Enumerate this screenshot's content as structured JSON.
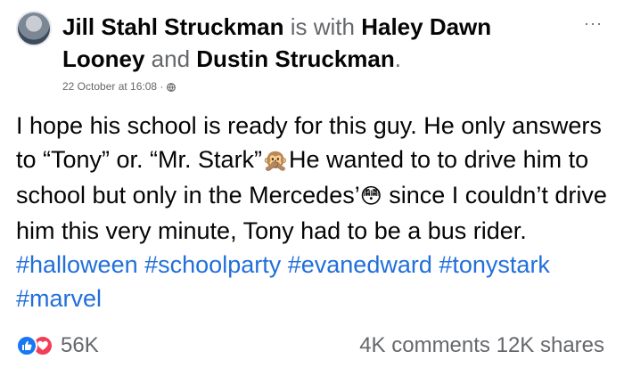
{
  "header": {
    "author": "Jill Stahl Struckman",
    "with_text": " is with ",
    "tagged_1": "Haley Dawn Looney",
    "and_text": " and ",
    "tagged_2": "Dustin Struckman",
    "end_period": ".",
    "timestamp": "22 October at 16:08 ·",
    "privacy_icon": "globe-icon",
    "more_label": "···"
  },
  "post": {
    "text_1": "I hope his school is ready for this guy. He only answers to “Tony” or. “Mr. Stark”",
    "emoji_1": "🙊",
    "text_2": "He wanted to to drive him to school but only in the Mercedes’",
    "emoji_2": "😳",
    "text_3": " since I couldn’t drive him this very minute, Tony had to be a bus rider. ",
    "hashtags": [
      "#halloween",
      "#schoolparty",
      "#evanedward",
      "#tonystark",
      "#marvel"
    ]
  },
  "footer": {
    "reaction_icons": [
      "like-icon",
      "love-icon"
    ],
    "reaction_count": "56K",
    "comments": "4K comments",
    "shares": "12K shares"
  },
  "colors": {
    "hashtag": "#216fdb",
    "like": "#1877f2",
    "love": "#f33e58",
    "secondary_text": "#65676b"
  }
}
